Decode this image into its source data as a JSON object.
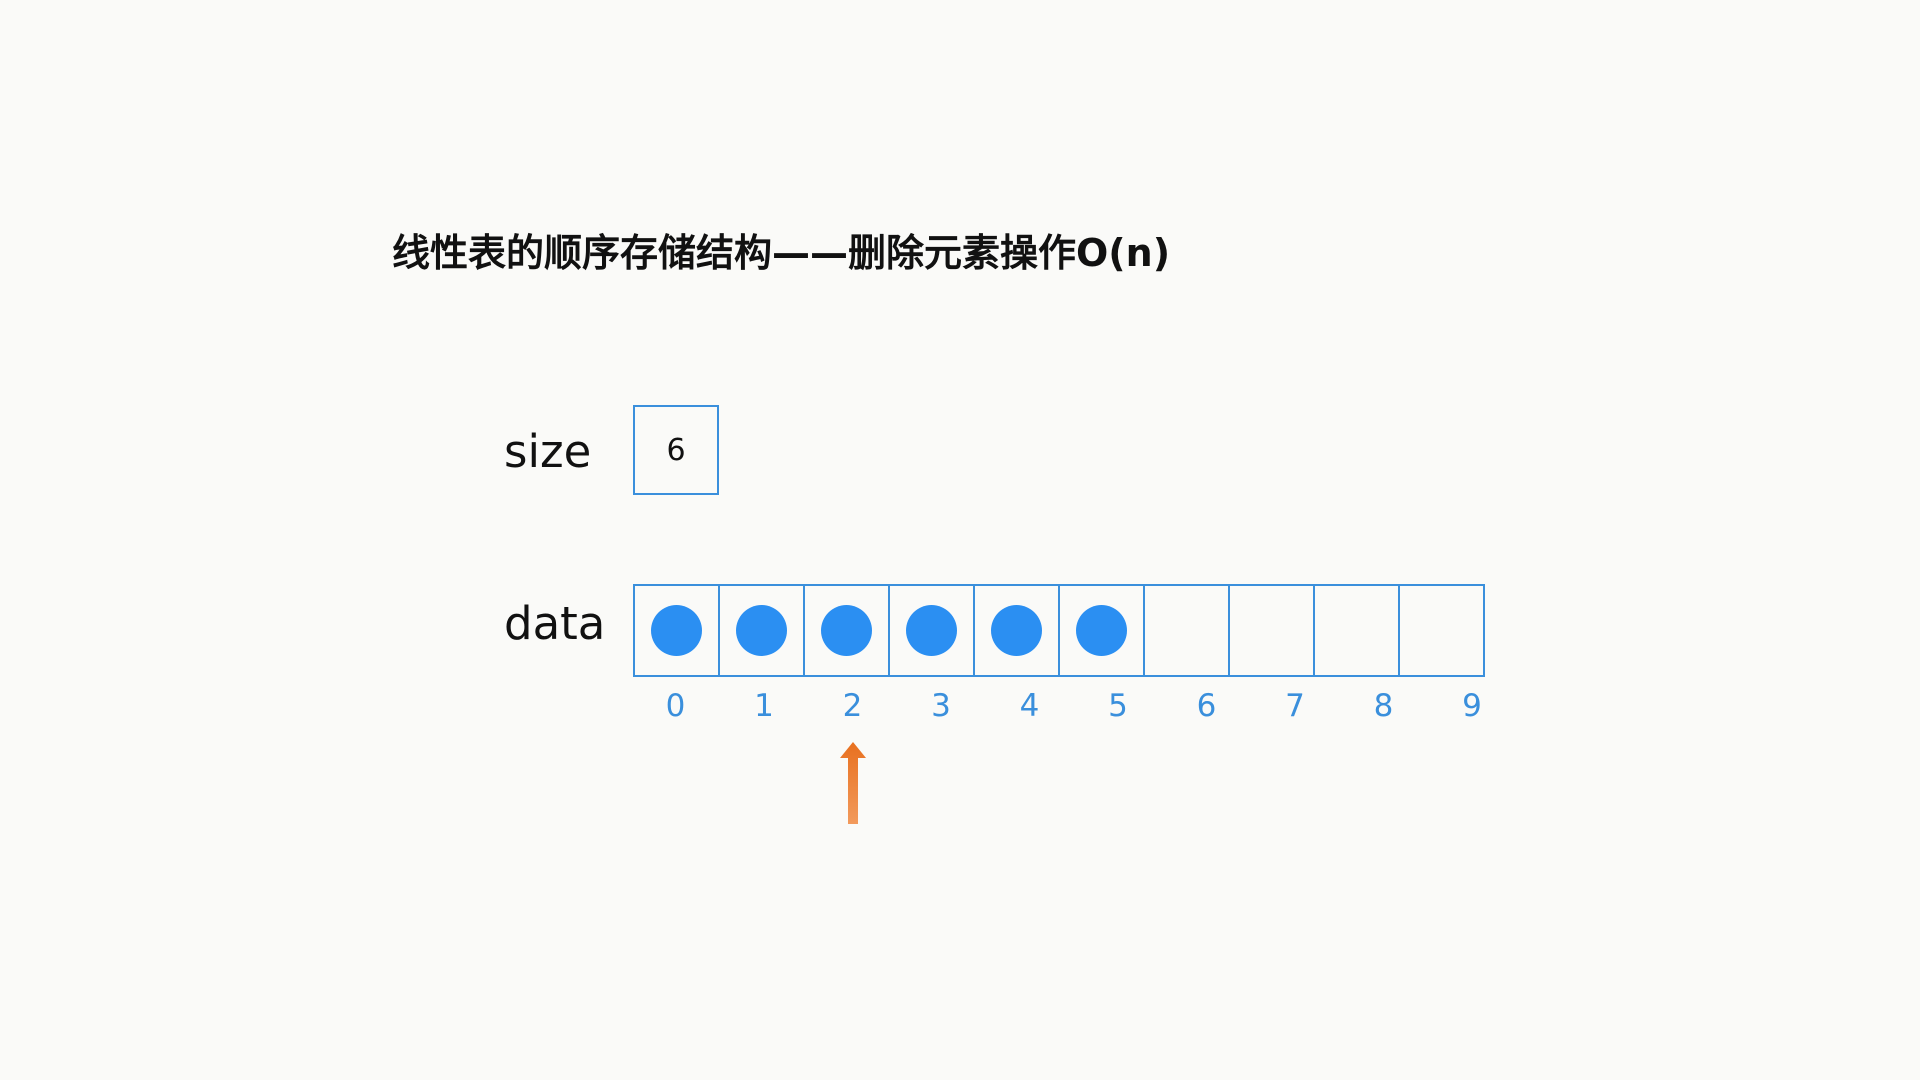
{
  "title": "线性表的顺序存储结构——删除元素操作O(n)",
  "size": {
    "label": "size",
    "value": "6"
  },
  "data": {
    "label": "data",
    "capacity": 10,
    "filled": 6,
    "indices": [
      "0",
      "1",
      "2",
      "3",
      "4",
      "5",
      "6",
      "7",
      "8",
      "9"
    ]
  },
  "pointer": {
    "target_index": 2,
    "icon": "up-arrow-icon",
    "color": "#e8701f"
  },
  "colors": {
    "accent": "#3a8fdc",
    "element": "#2b8ff2",
    "text": "#111111",
    "background": "#fafaf8"
  }
}
